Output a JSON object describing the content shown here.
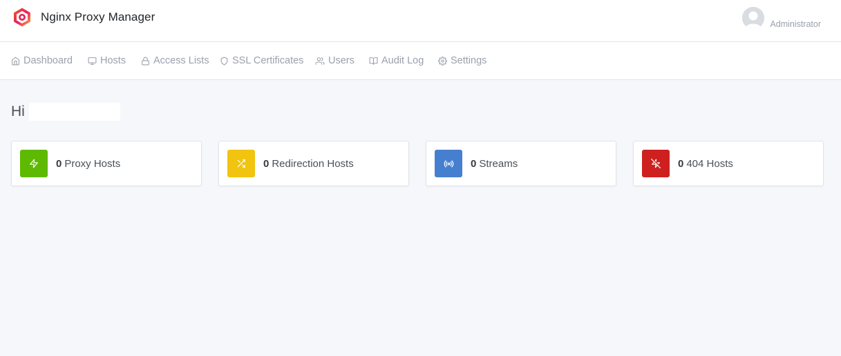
{
  "app": {
    "title": "Nginx Proxy Manager"
  },
  "user": {
    "role": "Administrator"
  },
  "nav": {
    "items": [
      {
        "label": "Dashboard",
        "icon": "home-icon"
      },
      {
        "label": "Hosts",
        "icon": "monitor-icon"
      },
      {
        "label": "Access Lists",
        "icon": "lock-icon"
      },
      {
        "label": "SSL Certificates",
        "icon": "shield-icon"
      },
      {
        "label": "Users",
        "icon": "users-icon"
      },
      {
        "label": "Audit Log",
        "icon": "book-icon"
      },
      {
        "label": "Settings",
        "icon": "gear-icon"
      }
    ]
  },
  "greeting": {
    "text": "Hi"
  },
  "stats": [
    {
      "count": "0",
      "label": "Proxy Hosts",
      "icon": "zap-icon",
      "color": "#5eba00"
    },
    {
      "count": "0",
      "label": "Redirection Hosts",
      "icon": "shuffle-icon",
      "color": "#f1c40f"
    },
    {
      "count": "0",
      "label": "Streams",
      "icon": "radio-icon",
      "color": "#467fcf"
    },
    {
      "count": "0",
      "label": "404 Hosts",
      "icon": "zap-off-icon",
      "color": "#cd201f"
    }
  ]
}
